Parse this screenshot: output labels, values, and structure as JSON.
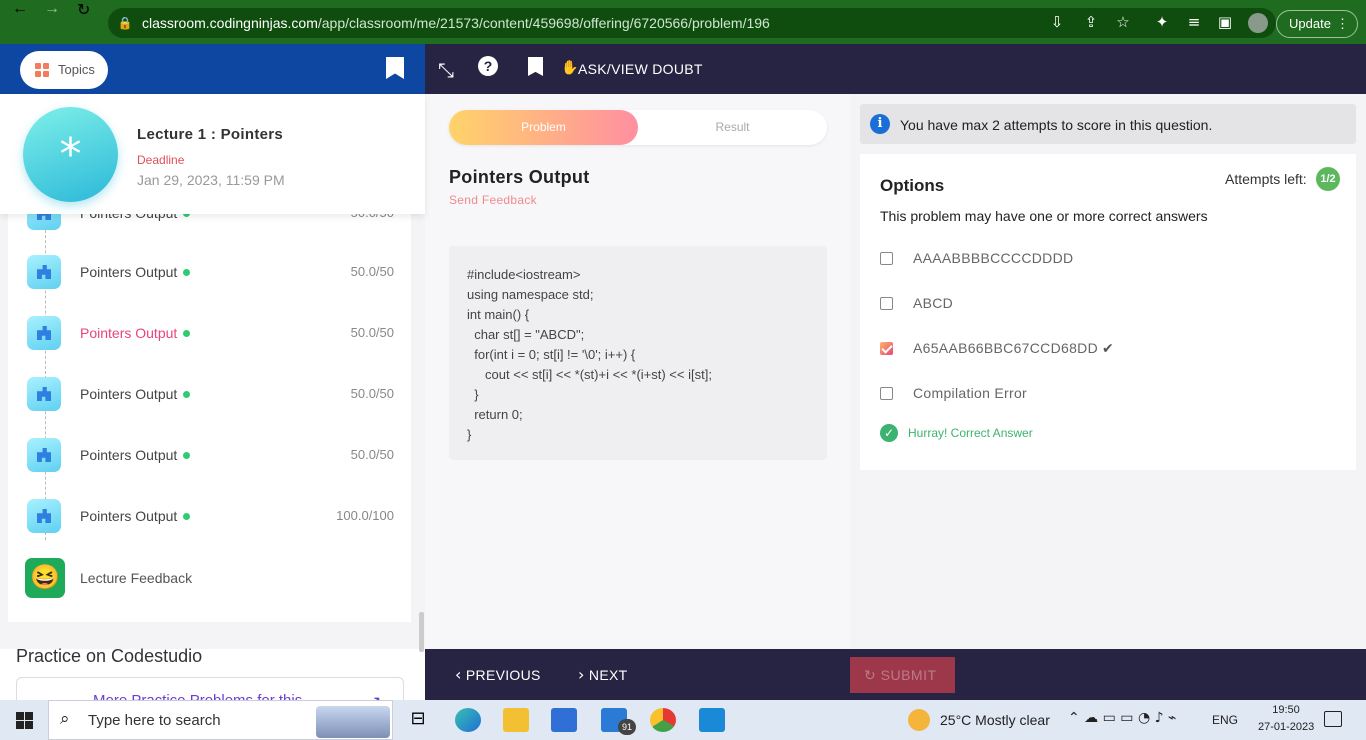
{
  "browser": {
    "url_domain": "classroom.codingninjas.com",
    "url_path": "/app/classroom/me/21573/content/459698/offering/6720566/problem/196",
    "update_label": "Update"
  },
  "sidebar": {
    "topics_label": "Topics",
    "lecture_title": "Lecture 1 : Pointers",
    "deadline_label": "Deadline",
    "deadline_date": "Jan 29, 2023, 11:59 PM",
    "items": [
      {
        "label": "Pointers Output",
        "score": "50.0/50"
      },
      {
        "label": "Pointers Output",
        "score": "50.0/50"
      },
      {
        "label": "Pointers Output",
        "score": "50.0/50"
      },
      {
        "label": "Pointers Output",
        "score": "50.0/50"
      },
      {
        "label": "Pointers Output",
        "score": "50.0/50"
      },
      {
        "label": "Pointers Output",
        "score": "100.0/100"
      }
    ],
    "feedback_label": "Lecture Feedback",
    "practice_title": "Practice on Codestudio",
    "practice_link": "More Practice Problems for this"
  },
  "toolbar": {
    "ask_doubt": "ASK/VIEW DOUBT"
  },
  "problem": {
    "tab_problem": "Problem",
    "tab_result": "Result",
    "title": "Pointers Output",
    "send_feedback": "Send Feedback",
    "code_lines": [
      "#include<iostream>",
      "using namespace std;",
      "int main() {",
      "  char st[] = \"ABCD\";",
      "  for(int i = 0; st[i] != '\\0'; i++) {",
      "     cout << st[i] << *(st)+i << *(i+st) << i[st];",
      "  }",
      "  return 0;",
      "}"
    ]
  },
  "answer": {
    "info": "You have max 2 attempts to score in this question.",
    "options_title": "Options",
    "attempts_label": "Attempts left:",
    "attempts_value": "1/2",
    "multi_note": "This problem may have one or more correct answers",
    "options": [
      {
        "text": "AAAABBBBCCCCDDDD",
        "checked": false
      },
      {
        "text": "ABCD",
        "checked": false
      },
      {
        "text": "A65AAB66BBC67CCD68DD",
        "checked": true
      },
      {
        "text": "Compilation Error",
        "checked": false
      }
    ],
    "result_text": "Hurray! Correct Answer"
  },
  "footer": {
    "previous": "PREVIOUS",
    "next": "NEXT",
    "submit": "SUBMIT"
  },
  "taskbar": {
    "search_placeholder": "Type here to search",
    "weather": "25°C  Mostly clear",
    "lang": "ENG",
    "time": "19:50",
    "date": "27-01-2023",
    "mail_badge": "91"
  },
  "colors": {
    "brand_blue": "#0d47a1",
    "dark_bar": "#272343",
    "active_item": "#e8457a",
    "success": "#3cb371"
  }
}
